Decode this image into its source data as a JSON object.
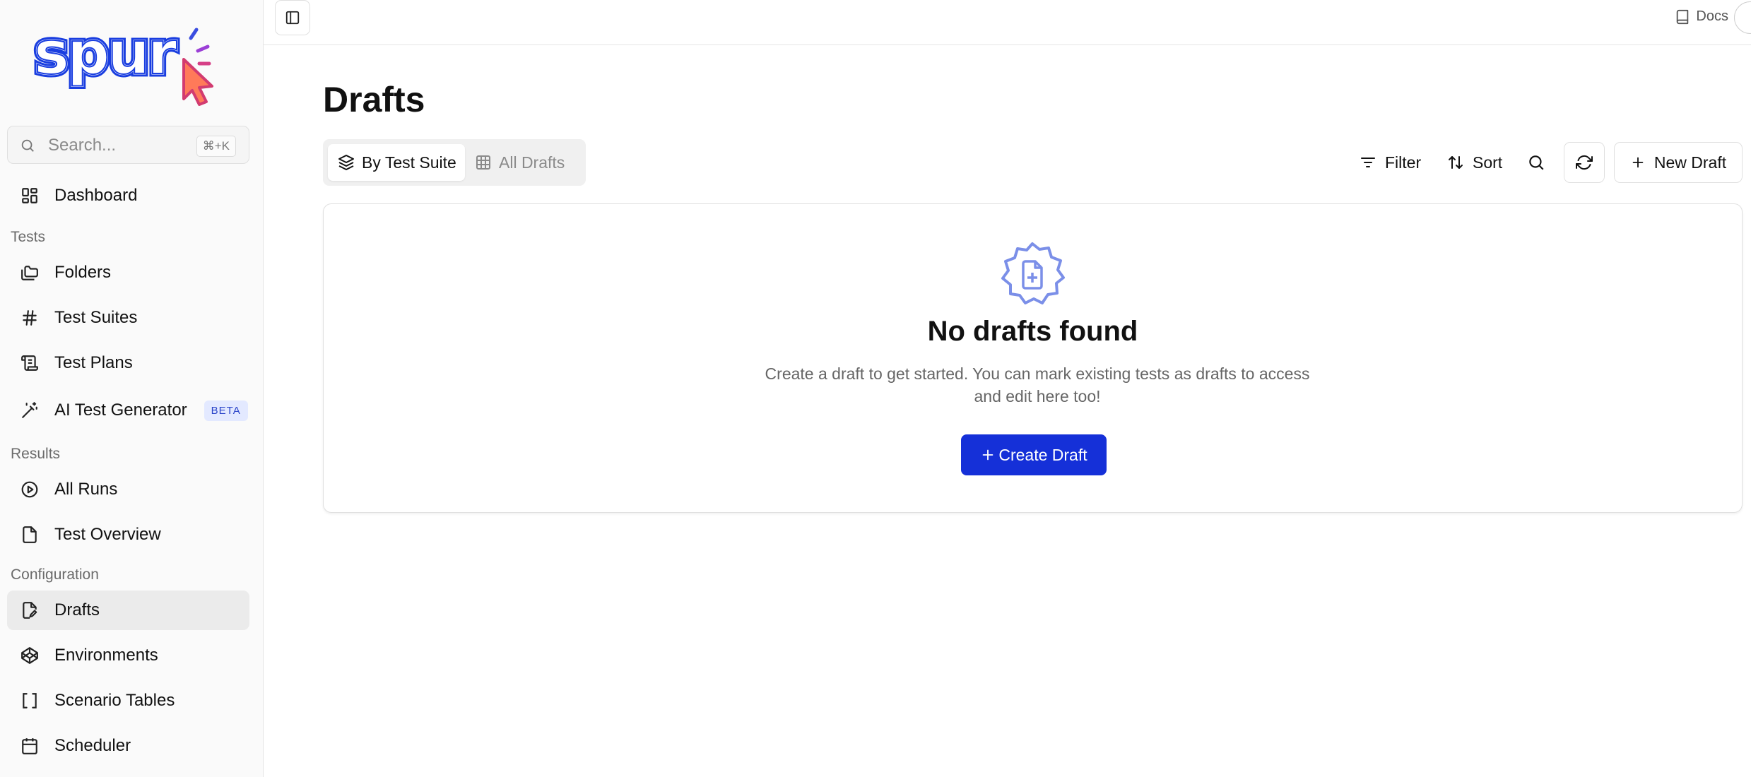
{
  "app": {
    "logo_text": "spur"
  },
  "search": {
    "placeholder": "Search...",
    "shortcut": "⌘+K"
  },
  "sidebar": {
    "dashboard": {
      "label": "Dashboard",
      "icon": "dashboard-grid-icon"
    },
    "sections": {
      "tests": "Tests",
      "results": "Results",
      "configuration": "Configuration"
    },
    "tests_items": [
      {
        "label": "Folders",
        "icon": "folders-icon"
      },
      {
        "label": "Test Suites",
        "icon": "hash-icon"
      },
      {
        "label": "Test Plans",
        "icon": "scroll-icon"
      },
      {
        "label": "AI Test Generator",
        "icon": "magic-wand-icon",
        "badge": "BETA"
      }
    ],
    "results_items": [
      {
        "label": "All Runs",
        "icon": "play-circle-icon"
      },
      {
        "label": "Test Overview",
        "icon": "file-icon"
      }
    ],
    "configuration_items": [
      {
        "label": "Drafts",
        "icon": "file-pen-icon",
        "active": true
      },
      {
        "label": "Environments",
        "icon": "codepen-icon"
      },
      {
        "label": "Scenario Tables",
        "icon": "brackets-icon"
      },
      {
        "label": "Scheduler",
        "icon": "calendar-icon"
      }
    ]
  },
  "topbar": {
    "docs_label": "Docs"
  },
  "page": {
    "title": "Drafts",
    "view_tabs": [
      {
        "label": "By Test Suite",
        "icon": "layers-icon",
        "active": true
      },
      {
        "label": "All Drafts",
        "icon": "table-icon",
        "active": false
      }
    ],
    "toolbar": {
      "filter_label": "Filter",
      "sort_label": "Sort",
      "new_draft_label": "New Draft"
    },
    "empty_state": {
      "title": "No drafts found",
      "description": "Create a draft to get started. You can mark existing tests as drafts to access and edit here too!",
      "button_label": "Create Draft"
    }
  },
  "colors": {
    "primary_button": "#1530d8",
    "empty_icon": "#7b8fe8",
    "active_nav": "#ebebeb",
    "beta_badge_bg": "#e3e9ff",
    "beta_badge_text": "#2a44c9",
    "logo_blue": "#1a3ee0"
  }
}
